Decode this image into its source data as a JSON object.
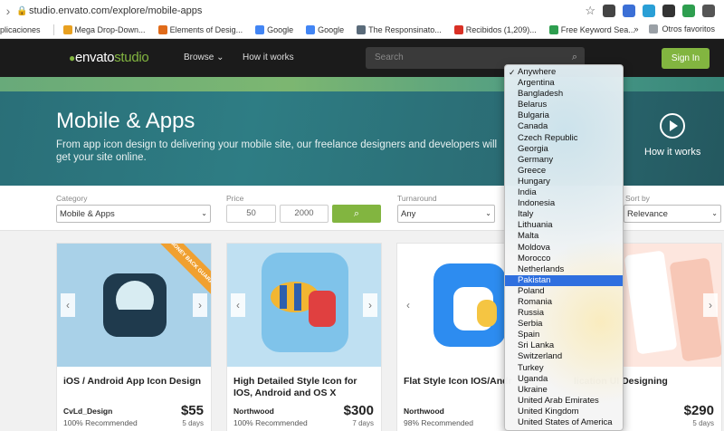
{
  "browser": {
    "url": "studio.envato.com/explore/mobile-apps",
    "bookmarks": [
      {
        "label": "plicaciones",
        "color": "#4285f4"
      },
      {
        "label": "Mega Drop-Down...",
        "color": "#e8a020"
      },
      {
        "label": "Elements of Desig...",
        "color": "#e06b1a"
      },
      {
        "label": "Google",
        "color": "#4285f4"
      },
      {
        "label": "Google",
        "color": "#4285f4"
      },
      {
        "label": "The Responsinato...",
        "color": "#5a6b7a"
      },
      {
        "label": "Recibidos (1,209)...",
        "color": "#d93025"
      },
      {
        "label": "Free Keyword Sea...",
        "color": "#2e9e4f"
      }
    ],
    "more_bookmarks": "»",
    "other_favorites": "Otros favoritos"
  },
  "nav": {
    "logo_main": "envato",
    "logo_sub": "studio",
    "browse": "Browse",
    "how_it_works": "How it works",
    "search_placeholder": "Search",
    "sign_in": "Sign In"
  },
  "hero": {
    "title": "Mobile & Apps",
    "subtitle": "From app icon design to delivering your mobile site, our freelance designers and developers will get your site online.",
    "how_it_works": "How it works"
  },
  "filters": {
    "category_label": "Category",
    "category_value": "Mobile & Apps",
    "price_label": "Price",
    "price_min": "50",
    "price_max": "2000",
    "turnaround_label": "Turnaround",
    "turnaround_value": "Any",
    "sort_label": "Sort by",
    "sort_value": "Relevance"
  },
  "cards": [
    {
      "title": "iOS / Android App Icon Design",
      "author": "CvLd_Design",
      "recommended": "100% Recommended",
      "price": "$55",
      "days": "5 days",
      "ribbon": "100% MONEY BACK GUARANTEE"
    },
    {
      "title": "High Detailed Style Icon for IOS, Android and OS X",
      "author": "Northwood",
      "recommended": "100% Recommended",
      "price": "$300",
      "days": "7 days"
    },
    {
      "title": "Flat Style Icon IOS/Andr",
      "author": "Northwood",
      "recommended": "98% Recommended",
      "price": "",
      "days": ""
    },
    {
      "title": "lication UI Designing",
      "author": "",
      "recommended": "ommended",
      "price": "$290",
      "days": "5 days"
    }
  ],
  "dropdown": {
    "selected": "Pakistan",
    "checked": "Anywhere",
    "options": [
      "Anywhere",
      "Argentina",
      "Bangladesh",
      "Belarus",
      "Bulgaria",
      "Canada",
      "Czech Republic",
      "Georgia",
      "Germany",
      "Greece",
      "Hungary",
      "India",
      "Indonesia",
      "Italy",
      "Lithuania",
      "Malta",
      "Moldova",
      "Morocco",
      "Netherlands",
      "Pakistan",
      "Poland",
      "Romania",
      "Russia",
      "Serbia",
      "Spain",
      "Sri Lanka",
      "Switzerland",
      "Turkey",
      "Uganda",
      "Ukraine",
      "United Arab Emirates",
      "United Kingdom",
      "United States of America"
    ]
  }
}
